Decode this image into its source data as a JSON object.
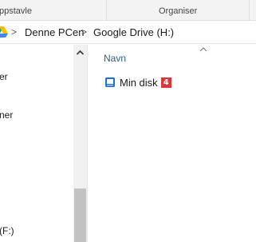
{
  "ribbon": {
    "groups": [
      {
        "label": "ppstavle"
      },
      {
        "label": "Organiser"
      }
    ]
  },
  "address": {
    "icon": "google-drive-icon",
    "crumbs": [
      {
        "label": "Denne PCen"
      },
      {
        "label": "Google Drive (H:)"
      }
    ],
    "separator": ">"
  },
  "nav": {
    "items": [
      {
        "label": "er"
      },
      {
        "label": "ner"
      },
      {
        "label": "(F:)"
      }
    ]
  },
  "main": {
    "column_header": "Navn",
    "items": [
      {
        "label": "Min disk",
        "badge": "4",
        "icon": "drive-folder-icon"
      }
    ]
  },
  "colors": {
    "accent": "#2e5f8a",
    "badge": "#d43a3a"
  }
}
